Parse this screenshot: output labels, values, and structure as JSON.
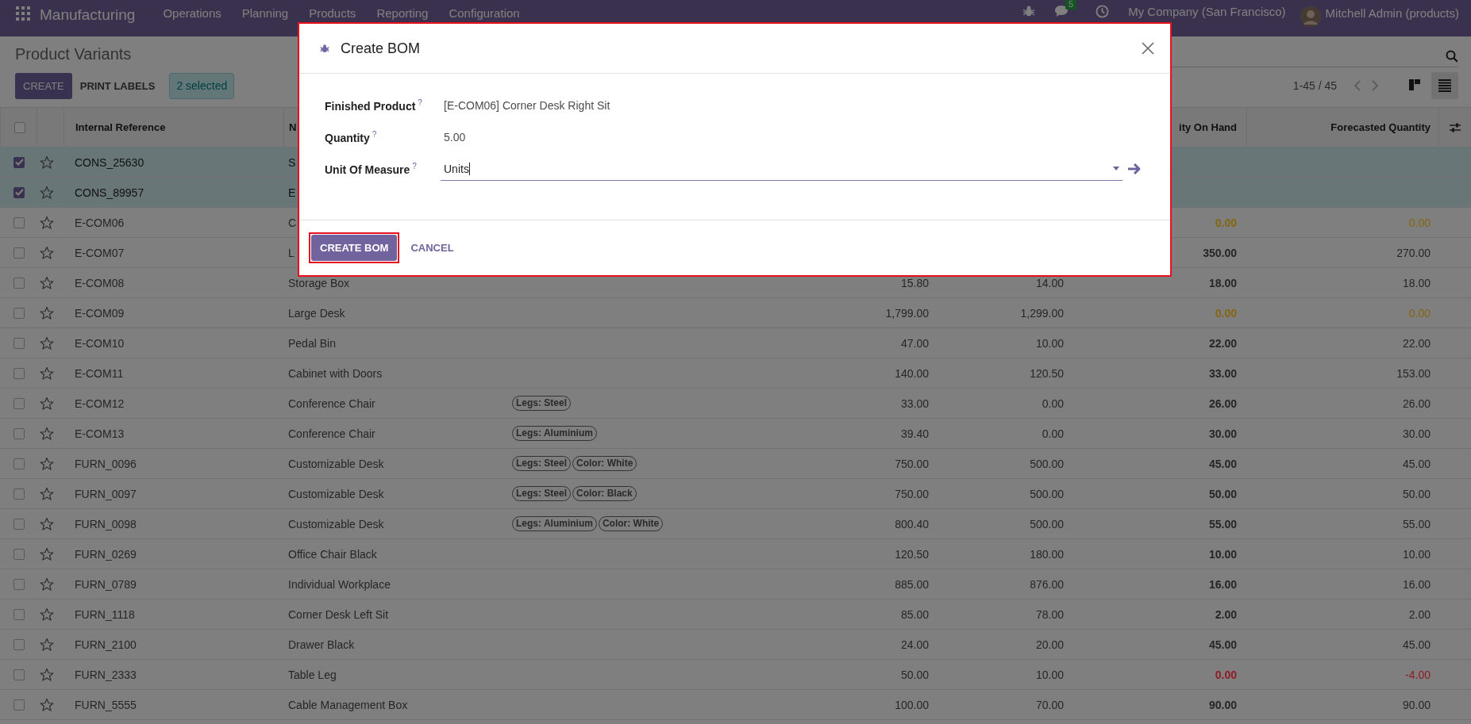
{
  "navbar": {
    "app_name": "Manufacturing",
    "menus": [
      "Operations",
      "Planning",
      "Products",
      "Reporting",
      "Configuration"
    ],
    "message_count": "5",
    "company": "My Company (San Francisco)",
    "user": "Mitchell Admin (products)"
  },
  "control_panel": {
    "title": "Product Variants",
    "buttons": [
      {
        "label": "CREATE",
        "kind": "primary"
      },
      {
        "label": "PRINT LABELS",
        "kind": "secondary"
      }
    ],
    "selection_badge": "2 selected",
    "pager": "1-45 / 45",
    "views": [
      {
        "kind": "kanban",
        "selected": false
      },
      {
        "kind": "list",
        "selected": true
      }
    ]
  },
  "table": {
    "select_all_checked": false,
    "header": {
      "reference": "Internal Reference",
      "name": "N",
      "on_hand": "ity On Hand",
      "forecasted": "Forecasted Quantity"
    },
    "rows": [
      {
        "reference": "CONS_25630",
        "name": "S",
        "selected": true,
        "favorite": false
      },
      {
        "reference": "CONS_89957",
        "name": "E",
        "selected": true,
        "favorite": false
      },
      {
        "reference": "E-COM06",
        "name": "C",
        "on_hand": "0.00",
        "forecasted": "0.00",
        "selected": false,
        "favorite": false,
        "color": "#85650e"
      },
      {
        "reference": "E-COM07",
        "name": "L",
        "on_hand": "350.00",
        "forecasted": "270.00",
        "selected": false,
        "favorite": false,
        "color": "#262626"
      },
      {
        "reference": "E-COM08",
        "name": "Storage Box",
        "sales_price": "15.80",
        "cost": "14.00",
        "on_hand": "18.00",
        "forecasted": "18.00",
        "selected": false,
        "favorite": false,
        "color": "#262626"
      },
      {
        "reference": "E-COM09",
        "name": "Large Desk",
        "sales_price": "1,799.00",
        "cost": "1,299.00",
        "on_hand": "0.00",
        "forecasted": "0.00",
        "selected": false,
        "favorite": false,
        "color": "#85650e"
      },
      {
        "reference": "E-COM10",
        "name": "Pedal Bin",
        "sales_price": "47.00",
        "cost": "10.00",
        "on_hand": "22.00",
        "forecasted": "22.00",
        "selected": false,
        "favorite": false,
        "color": "#262626"
      },
      {
        "reference": "E-COM11",
        "name": "Cabinet with Doors",
        "sales_price": "140.00",
        "cost": "120.50",
        "on_hand": "33.00",
        "forecasted": "153.00",
        "selected": false,
        "favorite": false,
        "color": "#262626"
      },
      {
        "reference": "E-COM12",
        "name": "Conference Chair",
        "tags": [
          "Legs: Steel"
        ],
        "sales_price": "33.00",
        "cost": "0.00",
        "on_hand": "26.00",
        "forecasted": "26.00",
        "selected": false,
        "favorite": false,
        "color": "#262626"
      },
      {
        "reference": "E-COM13",
        "name": "Conference Chair",
        "tags": [
          "Legs: Aluminium"
        ],
        "sales_price": "39.40",
        "cost": "0.00",
        "on_hand": "30.00",
        "forecasted": "30.00",
        "selected": false,
        "favorite": false,
        "color": "#262626"
      },
      {
        "reference": "FURN_0096",
        "name": "Customizable Desk",
        "tags": [
          "Legs: Steel",
          "Color: White"
        ],
        "sales_price": "750.00",
        "cost": "500.00",
        "on_hand": "45.00",
        "forecasted": "45.00",
        "selected": false,
        "favorite": false,
        "color": "#262626"
      },
      {
        "reference": "FURN_0097",
        "name": "Customizable Desk",
        "tags": [
          "Legs: Steel",
          "Color: Black"
        ],
        "sales_price": "750.00",
        "cost": "500.00",
        "on_hand": "50.00",
        "forecasted": "50.00",
        "selected": false,
        "favorite": false,
        "color": "#262626"
      },
      {
        "reference": "FURN_0098",
        "name": "Customizable Desk",
        "tags": [
          "Legs: Aluminium",
          "Color: White"
        ],
        "sales_price": "800.40",
        "cost": "500.00",
        "on_hand": "55.00",
        "forecasted": "55.00",
        "selected": false,
        "favorite": false,
        "color": "#262626"
      },
      {
        "reference": "FURN_0269",
        "name": "Office Chair Black",
        "sales_price": "120.50",
        "cost": "180.00",
        "on_hand": "10.00",
        "forecasted": "10.00",
        "selected": false,
        "favorite": false,
        "color": "#262626"
      },
      {
        "reference": "FURN_0789",
        "name": "Individual Workplace",
        "sales_price": "885.00",
        "cost": "876.00",
        "on_hand": "16.00",
        "forecasted": "16.00",
        "selected": false,
        "favorite": false,
        "color": "#262626"
      },
      {
        "reference": "FURN_1118",
        "name": "Corner Desk Left Sit",
        "sales_price": "85.00",
        "cost": "78.00",
        "on_hand": "2.00",
        "forecasted": "2.00",
        "selected": false,
        "favorite": false,
        "color": "#262626"
      },
      {
        "reference": "FURN_2100",
        "name": "Drawer Black",
        "sales_price": "24.00",
        "cost": "20.00",
        "on_hand": "45.00",
        "forecasted": "45.00",
        "selected": false,
        "favorite": false,
        "color": "#262626"
      },
      {
        "reference": "FURN_2333",
        "name": "Table Leg",
        "sales_price": "50.00",
        "cost": "10.00",
        "on_hand": "0.00",
        "forecasted": "-4.00",
        "selected": false,
        "favorite": false,
        "color": "#8f1c24"
      },
      {
        "reference": "FURN_5555",
        "name": "Cable Management Box",
        "sales_price": "100.00",
        "cost": "70.00",
        "on_hand": "90.00",
        "forecasted": "90.00",
        "selected": false,
        "favorite": false,
        "color": "#262626"
      }
    ]
  },
  "dialog": {
    "title": "Create BOM",
    "highlighted": true,
    "fields": [
      {
        "label": "Finished Product",
        "help": "?",
        "value": "[E-COM06] Corner Desk Right Sit",
        "kind": "text"
      },
      {
        "label": "Quantity",
        "help": "?",
        "value": "5.00",
        "kind": "text"
      },
      {
        "label": "Unit Of Measure",
        "help": "?",
        "value": "Units",
        "kind": "select"
      }
    ],
    "buttons": [
      {
        "label": "CREATE BOM",
        "kind": "primary",
        "highlighted": true
      },
      {
        "label": "CANCEL",
        "kind": "link",
        "highlighted": false
      }
    ]
  }
}
